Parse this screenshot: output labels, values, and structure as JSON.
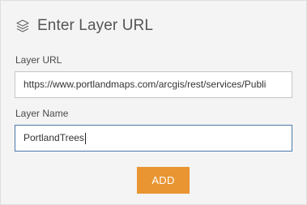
{
  "header": {
    "icon": "layers-icon",
    "title": "Enter Layer URL"
  },
  "form": {
    "layer_url": {
      "label": "Layer URL",
      "value": "https://www.portlandmaps.com/arcgis/rest/services/Publi"
    },
    "layer_name": {
      "label": "Layer Name",
      "value": "PortlandTrees"
    },
    "add_button_label": "ADD"
  },
  "colors": {
    "panel_background": "#f4f4f4",
    "accent": "#e99532",
    "focus_border": "#4b79a8"
  }
}
